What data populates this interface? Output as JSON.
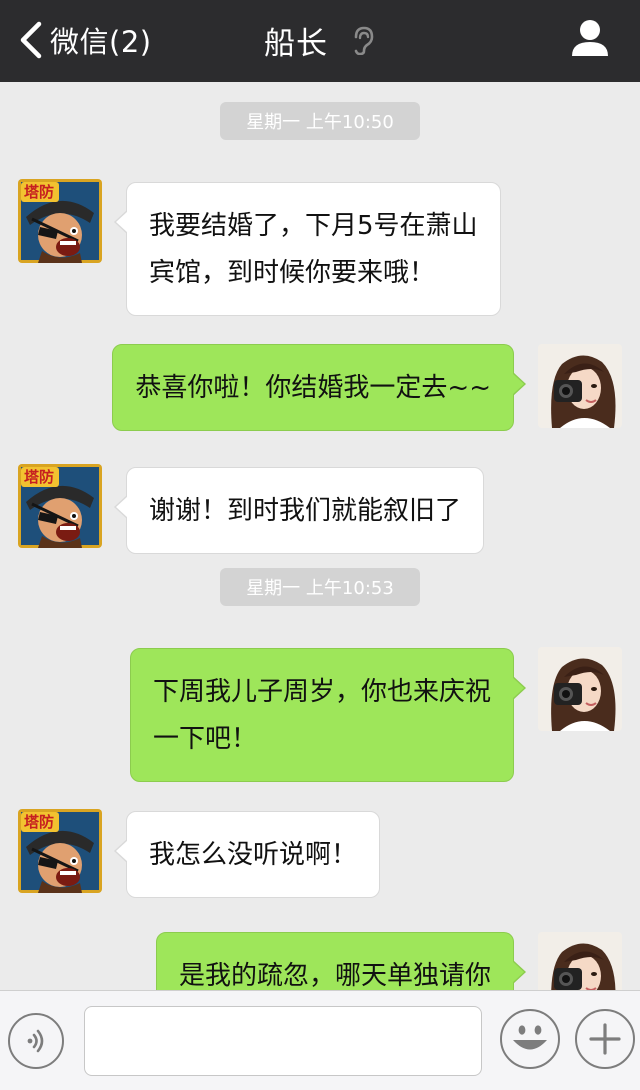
{
  "header": {
    "back_label": "微信(2)",
    "title": "船长",
    "icons": [
      "chevron-left-icon",
      "ear-icon",
      "person-icon"
    ]
  },
  "colors": {
    "header_bg": "#2c2c2e",
    "chat_bg": "#ebebeb",
    "outgoing_bubble": "#9ee65a",
    "incoming_bubble": "#ffffff",
    "timestamp_bg": "#d3d3d3"
  },
  "timestamps": [
    "星期一 上午10:50",
    "星期一 上午10:53"
  ],
  "avatars": {
    "contact": {
      "badge_text": "塔防"
    }
  },
  "messages": [
    {
      "sender": "contact",
      "lines": [
        "我要结婚了，下月5号在萧山",
        "宾馆，到时候你要来哦！"
      ]
    },
    {
      "sender": "me",
      "lines": [
        "恭喜你啦！你结婚我一定去~~"
      ]
    },
    {
      "sender": "contact",
      "lines": [
        "谢谢！到时我们就能叙旧了"
      ]
    },
    {
      "sender": "me",
      "lines": [
        "下周我儿子周岁，你也来庆祝",
        "一下吧！"
      ]
    },
    {
      "sender": "contact",
      "lines": [
        "我怎么没听说啊！"
      ]
    },
    {
      "sender": "me",
      "lines": [
        "是我的疏忽，哪天单独请你"
      ]
    }
  ],
  "input_bar": {
    "placeholder": "",
    "icons": [
      "voice-icon",
      "emoji-icon",
      "plus-icon"
    ]
  }
}
